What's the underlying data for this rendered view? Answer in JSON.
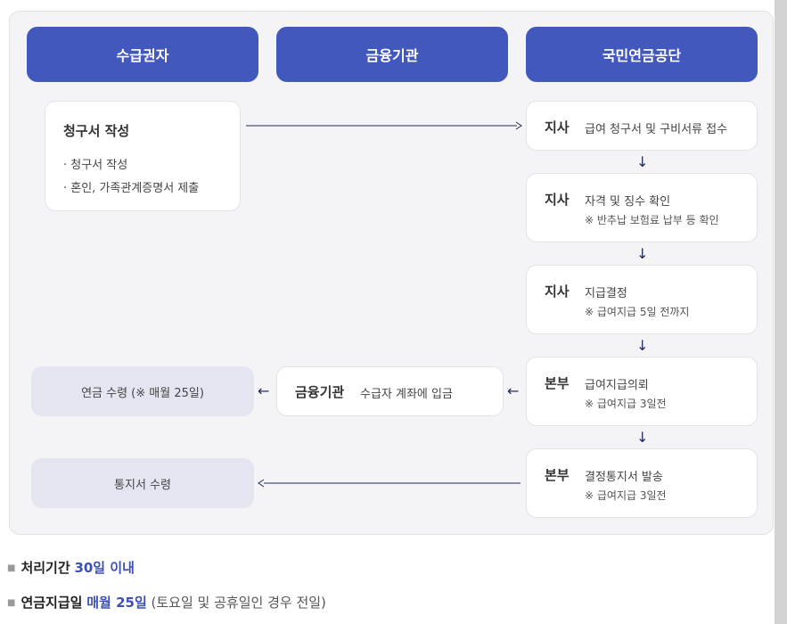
{
  "headers": [
    "수급권자",
    "금융기관",
    "국민연금공단"
  ],
  "claim": {
    "title": "청구서 작성",
    "items": [
      "· 청구서 작성",
      "· 혼인, 가족관계증명서 제출"
    ]
  },
  "steps": [
    {
      "agency": "지사",
      "desc": "급여 청구서 및 구비서류 접수",
      "note": ""
    },
    {
      "agency": "지사",
      "desc": "자격 및 징수 확인",
      "note": "※ 반추납 보험료 납부 등 확인"
    },
    {
      "agency": "지사",
      "desc": "지급결정",
      "note": "※ 급여지급 5일 전까지"
    },
    {
      "agency": "본부",
      "desc": "급여지급의뢰",
      "note": "※ 급여지급 3일전"
    },
    {
      "agency": "본부",
      "desc": "결정통지서 발송",
      "note": "※ 급여지급 3일전"
    }
  ],
  "bank": {
    "agency": "금융기관",
    "desc": "수급자 계좌에 입금"
  },
  "receive_pension": "연금 수령 (※ 매월 25일)",
  "receive_notice": "통지서 수령",
  "arrows": {
    "down": "↓",
    "left": "←"
  },
  "summary": {
    "period_label": "처리기간",
    "period_value": "30일 이내",
    "payday_label": "연금지급일",
    "payday_value": "매월 25일",
    "payday_note": "(토요일 및 공휴일인 경우 전일)"
  },
  "colors": {
    "header": "#4358bd",
    "accent": "#3d50b5",
    "receive_bg": "#e4e5f0",
    "line": "#1f2a5c"
  }
}
